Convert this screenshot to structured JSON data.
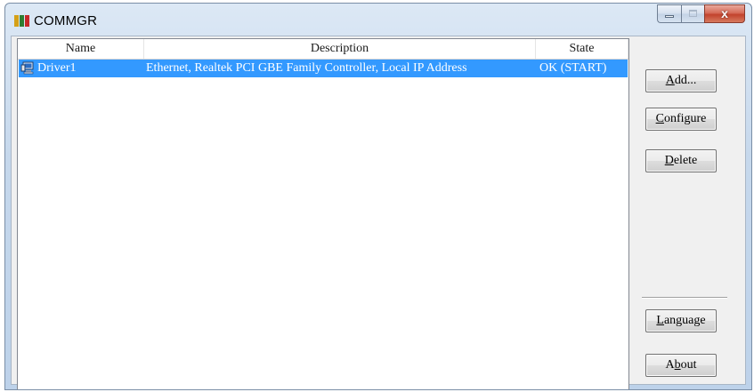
{
  "window": {
    "title": "COMMGR"
  },
  "colors": {
    "selection": "#3399ff",
    "icon_stripes": [
      "#d4a017",
      "#2e7d32",
      "#c62828"
    ]
  },
  "caption_buttons": {
    "close_glyph": "x"
  },
  "list": {
    "columns": [
      "Name",
      "Description",
      "State"
    ],
    "rows": [
      {
        "icon": "network-computer-icon",
        "name": "Driver1",
        "description": "Ethernet, Realtek PCI GBE Family Controller, Local IP Address",
        "state": "OK (START)",
        "selected": true
      }
    ]
  },
  "buttons": {
    "add": {
      "pre": "",
      "key": "A",
      "post": "dd..."
    },
    "configure": {
      "pre": "",
      "key": "C",
      "post": "onfigure"
    },
    "delete": {
      "pre": "",
      "key": "D",
      "post": "elete"
    },
    "language": {
      "pre": "",
      "key": "L",
      "post": "anguage"
    },
    "about": {
      "pre": "A",
      "key": "b",
      "post": "out"
    }
  }
}
